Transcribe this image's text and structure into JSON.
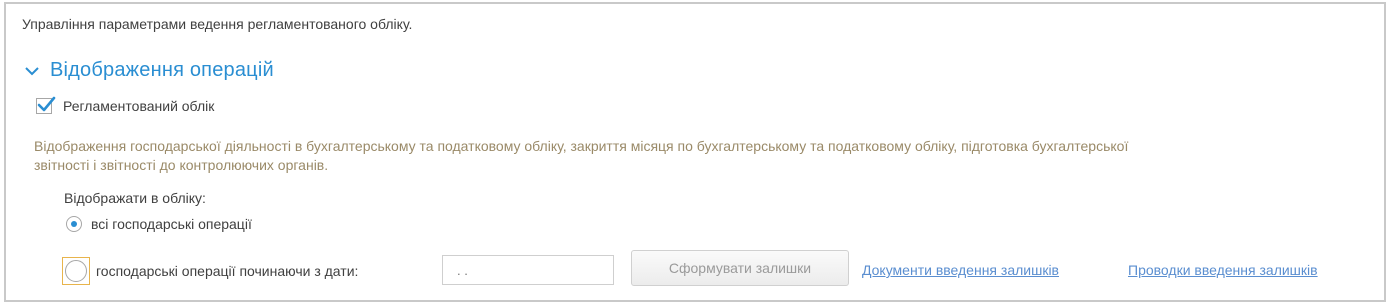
{
  "intro_text": "Управління параметрами ведення регламентованого обліку.",
  "section": {
    "title": "Відображення операцій",
    "expanded": true,
    "accent_color": "#2a8ed2"
  },
  "regulated_accounting": {
    "label": "Регламентований облік",
    "checked": true
  },
  "description": "Відображення господарської діяльності в бухгалтерському та податковому обліку, закриття місяця по бухгалтерському та податковому обліку, підготовка бухгалтерської звітності і звітності до контролюючих органів.",
  "display_in_accounting": {
    "label": "Відображати в обліку:",
    "options": [
      {
        "label": "всі господарські операції",
        "selected": true
      },
      {
        "label": "господарські операції починаючи з дати:",
        "selected": false
      }
    ],
    "date_value": ". .",
    "date_icon": "calendar-icon"
  },
  "form_balances_button": "Сформувати залишки",
  "links": {
    "balances_documents": "Документи введення залишків",
    "balances_entries": "Проводки введення залишків"
  }
}
